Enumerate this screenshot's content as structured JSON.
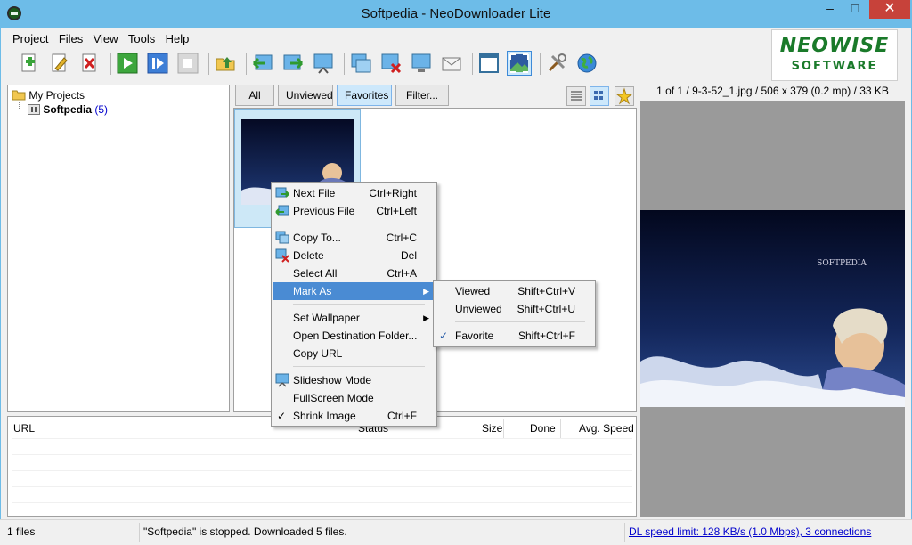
{
  "window": {
    "title": "Softpedia - NeoDownloader Lite",
    "min": "–",
    "max": "□",
    "close": "✕"
  },
  "menubar": [
    "Project",
    "Files",
    "View",
    "Tools",
    "Help"
  ],
  "logo": {
    "line1": "NEOWISE",
    "line2": "SOFTWARE"
  },
  "tree": {
    "root": "My Projects",
    "child": "Softpedia",
    "count": "(5)"
  },
  "filters": {
    "all": "All",
    "unviewed": "Unviewed",
    "favorites": "Favorites",
    "filter": "Filter..."
  },
  "context_menu": {
    "items": [
      {
        "label": "Next File",
        "shortcut": "Ctrl+Right"
      },
      {
        "label": "Previous File",
        "shortcut": "Ctrl+Left"
      },
      {
        "label": "Copy To...",
        "shortcut": "Ctrl+C"
      },
      {
        "label": "Delete",
        "shortcut": "Del"
      },
      {
        "label": "Select All",
        "shortcut": "Ctrl+A"
      },
      {
        "label": "Mark As",
        "shortcut": ""
      },
      {
        "label": "Set Wallpaper",
        "shortcut": ""
      },
      {
        "label": "Open Destination Folder...",
        "shortcut": ""
      },
      {
        "label": "Copy URL",
        "shortcut": ""
      },
      {
        "label": "Slideshow Mode",
        "shortcut": ""
      },
      {
        "label": "FullScreen Mode",
        "shortcut": ""
      },
      {
        "label": "Shrink Image",
        "shortcut": "Ctrl+F"
      }
    ]
  },
  "submenu": {
    "items": [
      {
        "label": "Viewed",
        "shortcut": "Shift+Ctrl+V"
      },
      {
        "label": "Unviewed",
        "shortcut": "Shift+Ctrl+U"
      },
      {
        "label": "Favorite",
        "shortcut": "Shift+Ctrl+F"
      }
    ]
  },
  "dl_list": {
    "col_url": "URL",
    "col_status": "Status",
    "col_size": "Size",
    "col_done": "Done",
    "col_speed": "Avg. Speed"
  },
  "preview": {
    "info": "1 of 1 / 9-3-52_1.jpg / 506 x 379 (0.2 mp) / 33 KB",
    "watermark": "SOFTPEDIA"
  },
  "status": {
    "files": "1 files",
    "message": "\"Softpedia\" is stopped. Downloaded 5 files.",
    "speed": "DL speed limit: 128 KB/s (1.0 Mbps), 3 connections"
  },
  "colors": {
    "titlebar": "#6dbce8",
    "highlight": "#4a8bd3",
    "close": "#c7423a",
    "link": "#0000cc",
    "logo": "#1a7a2a"
  }
}
